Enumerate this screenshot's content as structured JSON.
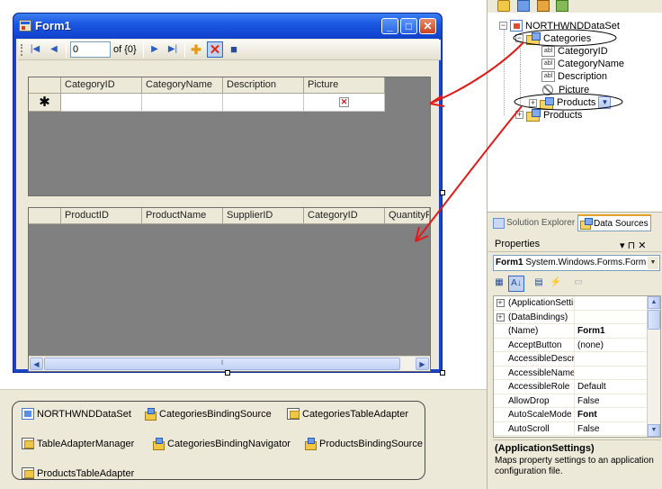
{
  "form": {
    "title": "Form1",
    "navigator": {
      "position": "0",
      "count": "of {0}"
    },
    "categories_grid": {
      "columns": [
        "CategoryID",
        "CategoryName",
        "Description",
        "Picture"
      ],
      "new_row_marker": "✱"
    },
    "products_grid": {
      "columns": [
        "ProductID",
        "ProductName",
        "SupplierID",
        "CategoryID",
        "QuantityP"
      ]
    }
  },
  "tray": {
    "components": [
      "NORTHWNDDataSet",
      "CategoriesBindingSource",
      "CategoriesTableAdapter",
      "TableAdapterManager",
      "CategoriesBindingNavigator",
      "ProductsBindingSource",
      "ProductsTableAdapter"
    ]
  },
  "data_sources": {
    "tree": {
      "root": "NORTHWNDDataSet",
      "categories": "Categories",
      "fields": [
        "CategoryID",
        "CategoryName",
        "Description",
        "Picture"
      ],
      "field_icons": [
        "abl",
        "abl",
        "abl"
      ],
      "nested_products": "Products",
      "products": "Products"
    },
    "tabs": {
      "solution_explorer": "Solution Explorer",
      "data_sources": "Data Sources"
    }
  },
  "properties": {
    "title": "Properties",
    "pin": "▾ ⊓ ✕",
    "object_name": "Form1",
    "object_type": "System.Windows.Forms.Form",
    "rows": [
      {
        "name": "(ApplicationSettir",
        "value": "",
        "expandable": true,
        "bold": false
      },
      {
        "name": "(DataBindings)",
        "value": "",
        "expandable": true,
        "bold": false
      },
      {
        "name": "(Name)",
        "value": "Form1",
        "expandable": false,
        "bold": true
      },
      {
        "name": "AcceptButton",
        "value": "(none)",
        "expandable": false,
        "bold": false
      },
      {
        "name": "AccessibleDescrip",
        "value": "",
        "expandable": false,
        "bold": false
      },
      {
        "name": "AccessibleName",
        "value": "",
        "expandable": false,
        "bold": false
      },
      {
        "name": "AccessibleRole",
        "value": "Default",
        "expandable": false,
        "bold": false
      },
      {
        "name": "AllowDrop",
        "value": "False",
        "expandable": false,
        "bold": false
      },
      {
        "name": "AutoScaleMode",
        "value": "Font",
        "expandable": false,
        "bold": true
      },
      {
        "name": "AutoScroll",
        "value": "False",
        "expandable": false,
        "bold": false
      }
    ],
    "description_title": "(ApplicationSettings)",
    "description_text": "Maps property settings to an application configuration file."
  },
  "colors": {
    "arrow": "#e01b1b",
    "form_title": "#1a58e3",
    "grid_background": "#808080"
  }
}
